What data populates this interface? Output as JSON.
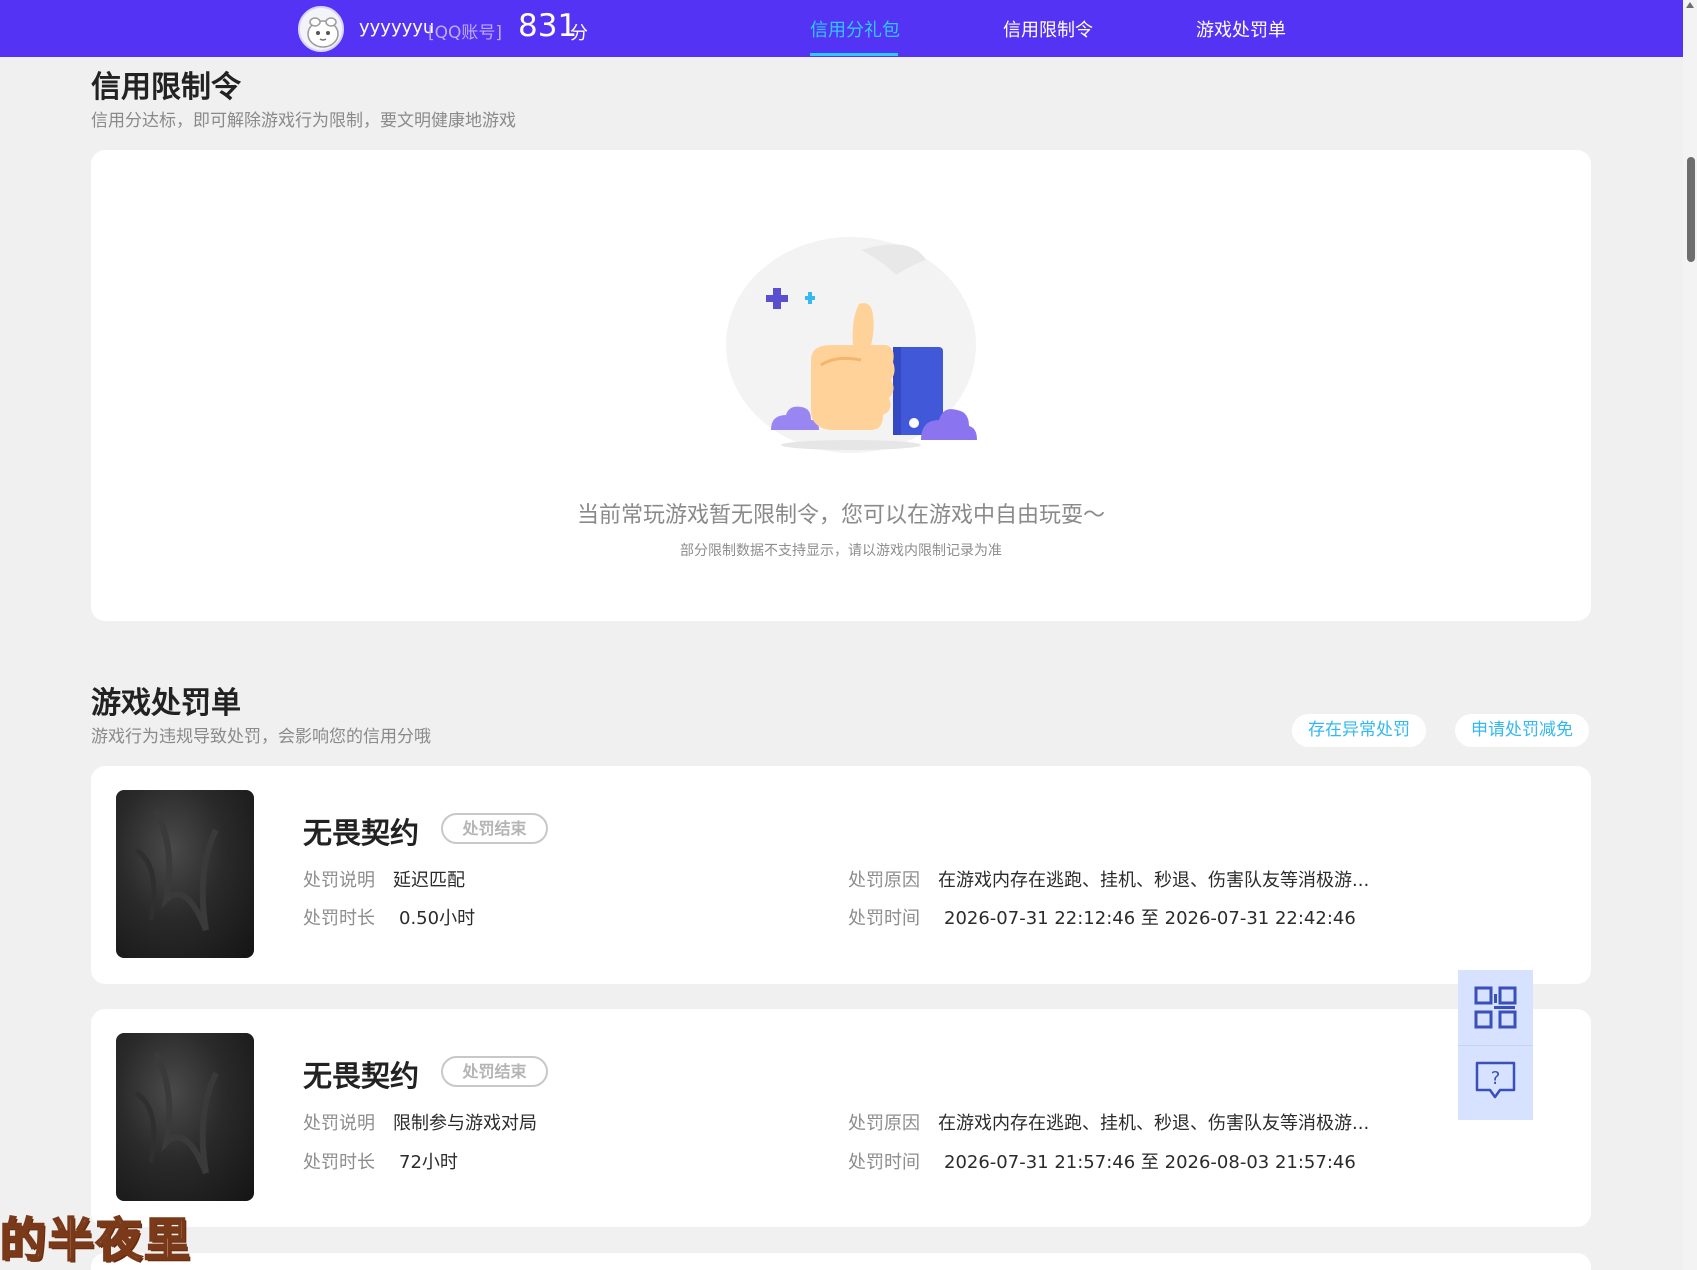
{
  "header": {
    "username": "yyyyyyu",
    "account_type": "[QQ账号]",
    "score": "831",
    "score_unit": "分",
    "nav": [
      {
        "label": "信用分礼包",
        "active": true
      },
      {
        "label": "信用限制令",
        "active": false
      },
      {
        "label": "游戏处罚单",
        "active": false
      }
    ]
  },
  "restriction": {
    "title": "信用限制令",
    "subtitle": "信用分达标，即可解除游戏行为限制，要文明健康地游戏",
    "empty_title": "当前常玩游戏暂无限制令，您可以在游戏中自由玩耍～",
    "empty_note": "部分限制数据不支持显示，请以游戏内限制记录为准"
  },
  "penalty": {
    "title": "游戏处罚单",
    "subtitle": "游戏行为违规导致处罚，会影响您的信用分哦",
    "abnormal_label": "存在异常处罚",
    "appeal_label": "申请处罚减免",
    "labels": {
      "desc": "处罚说明",
      "duration": "处罚时长",
      "reason": "处罚原因",
      "time": "处罚时间"
    },
    "items": [
      {
        "game": "无畏契约",
        "status": "处罚结束",
        "desc": "延迟匹配",
        "duration": "0.50小时",
        "reason": "在游戏内存在逃跑、挂机、秒退、伤害队友等消极游...",
        "time": "2026-07-31 22:12:46 至 2026-07-31 22:42:46"
      },
      {
        "game": "无畏契约",
        "status": "处罚结束",
        "desc": "限制参与游戏对局",
        "duration": "72小时",
        "reason": "在游戏内存在逃跑、挂机、秒退、伤害队友等消极游...",
        "time": "2026-07-31 21:57:46 至 2026-08-03 21:57:46"
      }
    ]
  },
  "overlay": {
    "watermark": "的半夜里"
  },
  "colors": {
    "brand": "#5533f5",
    "accent": "#2ec9ff",
    "link": "#34b8f0"
  }
}
